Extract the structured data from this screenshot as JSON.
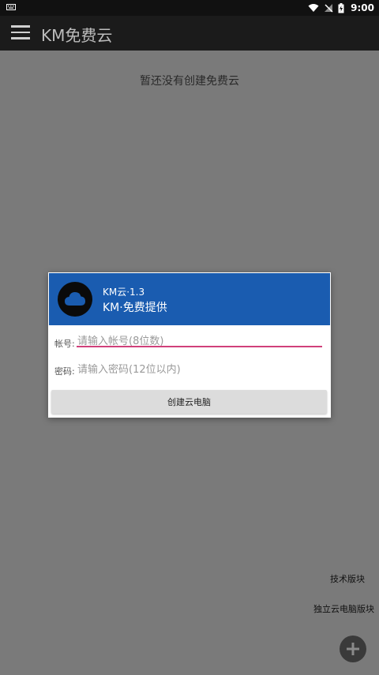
{
  "status_bar": {
    "time": "9:00"
  },
  "toolbar": {
    "title": "KM免费云"
  },
  "main": {
    "empty_message": "暂还没有创建免费云"
  },
  "dialog": {
    "title_line1": "KM云·1.3",
    "title_line2": "KM·免费提供",
    "account_label": "帐号:",
    "account_placeholder": "请输入帐号(8位数)",
    "password_label": "密码:",
    "password_placeholder": "请输入密码(12位以内)",
    "create_button": "创建云电脑",
    "header_color": "#1a5cb0",
    "focus_underline_color": "#d0407a"
  },
  "side_links": {
    "tech_section": "技术版块",
    "standalone_section": "独立云电脑版块"
  },
  "icons": {
    "status_left": "keyboard-icon",
    "wifi": "wifi-icon",
    "signal": "no-signal-icon",
    "battery": "battery-charging-icon",
    "menu": "hamburger-menu-icon",
    "logo": "cloud-icon",
    "fab": "plus-icon"
  }
}
